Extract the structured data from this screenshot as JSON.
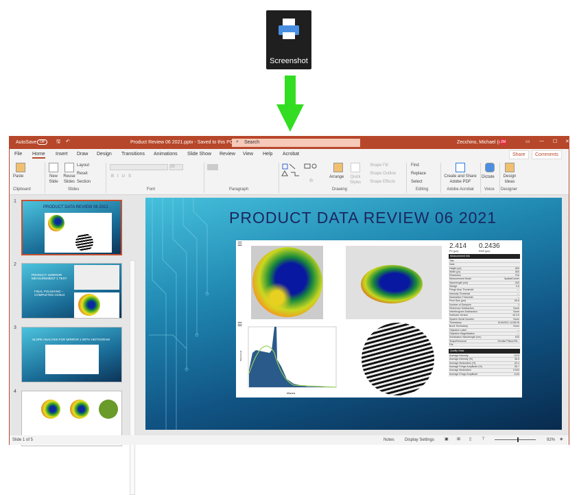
{
  "desktop": {
    "icon_label": "Screenshot",
    "arrow_color": "#33dd22"
  },
  "titlebar": {
    "autosave": "AutoSave",
    "autosave_state": "Off",
    "filename": "Product Review 06 2021.pptx - Saved to this PC",
    "search_placeholder": "Search",
    "user": "Zecchino, Michael (c)",
    "initials": "ZM",
    "accent": "#b7472a"
  },
  "tabs": [
    "File",
    "Home",
    "Insert",
    "Draw",
    "Design",
    "Transitions",
    "Animations",
    "Slide Show",
    "Review",
    "View",
    "Help",
    "Acrobat"
  ],
  "active_tab": "Home",
  "share": "Share",
  "comments": "Comments",
  "ribbon": {
    "clipboard": {
      "paste": "Paste",
      "group": "Clipboard"
    },
    "slides": {
      "new_slide": "New Slide",
      "reuse": "Reuse Slides",
      "layout": "Layout",
      "reset": "Reset",
      "section": "Section",
      "group": "Slides"
    },
    "font": {
      "size": "36",
      "group": "Font"
    },
    "paragraph": {
      "group": "Paragraph"
    },
    "drawing": {
      "arrange": "Arrange",
      "quick_styles": "Quick Styles",
      "shape_fill": "Shape Fill",
      "shape_outline": "Shape Outline",
      "shape_effects": "Shape Effects",
      "group": "Drawing"
    },
    "editing": {
      "find": "Find",
      "replace": "Replace",
      "select": "Select",
      "group": "Editing"
    },
    "acrobat": {
      "create": "Create and Share Adobe PDF",
      "group": "Adobe Acrobat"
    },
    "voice": {
      "dictate": "Dictate",
      "group": "Voice"
    },
    "designer": {
      "ideas": "Design Ideas",
      "group": "Designer"
    }
  },
  "thumbnails": [
    {
      "num": "1",
      "title": "PRODUCT DATA REVIEW 06 2021",
      "selected": true
    },
    {
      "num": "2",
      "text1": "PRODUCT 1MIRROR MEASUREMENT 1 TEXT",
      "text2": "FINAL POLISHING – COMPLETED 210613"
    },
    {
      "num": "3",
      "title": "SLOPE ANALYSIS FOR MIRROR 1 WITH HISTOGRAM"
    },
    {
      "num": "4"
    }
  ],
  "slide": {
    "title": "PRODUCT DATA REVIEW 06 2021",
    "pv": "2.414",
    "pv_label": "PV (µm)",
    "rms": "0.2436",
    "rms_label": "RMS (µm)",
    "measurement_header": "Measurement Info",
    "measurement_rows": [
      [
        "Title",
        ""
      ],
      [
        "Note",
        ""
      ],
      [
        "Height (px)",
        "800"
      ],
      [
        "Width (px)",
        "800"
      ],
      [
        "Resolution",
        "Full"
      ],
      [
        "Measurement Mode",
        "SpatialCarrier"
      ],
      [
        "Wavelength (nm)",
        "633"
      ],
      [
        "Wedge",
        "0.5"
      ],
      [
        "Fringe Amp Threshold",
        "---"
      ],
      [
        "Intensity Threshold",
        "---"
      ],
      [
        "Modulation Threshold",
        "---"
      ],
      [
        "Pixel Size (µm)",
        "50.8"
      ],
      [
        "Number of Samples",
        "1"
      ],
      [
        "Reference Subtraction",
        "None"
      ],
      [
        "Interferogram Subtraction",
        "None"
      ],
      [
        "Software Version",
        "v5.3.5"
      ],
      [
        "System Serial Number",
        "None"
      ],
      [
        "Timestamp",
        "6/16/2021 14:58:35"
      ],
      [
        "Burst Timestamp",
        "None"
      ],
      [
        "Objective Label",
        "---"
      ],
      [
        "Objective Magnification",
        "---"
      ],
      [
        "Illumination Wavelength (nm)",
        "633"
      ],
      [
        "ShapeRemoval",
        "Zernike Piston/Tilt..."
      ],
      [
        "File",
        ""
      ]
    ],
    "quality_header": "Quality Stats",
    "quality_rows": [
      [
        "Average Intensity",
        "1375"
      ],
      [
        "Average Intensity (%)",
        "38.5"
      ],
      [
        "Average Modulation (%)",
        "63.4"
      ],
      [
        "Average Fringe Amplitude (%)",
        "55.7"
      ],
      [
        "Average Modulation",
        "0.634"
      ],
      [
        "Average Fringe Amplitude",
        "1140"
      ]
    ],
    "histogram": {
      "xlabel": "Microns",
      "ylabel": "Pixel Count"
    }
  },
  "status": {
    "slide": "Slide 1 of 5",
    "notes": "Notes",
    "display": "Display Settings",
    "zoom": "92%"
  }
}
